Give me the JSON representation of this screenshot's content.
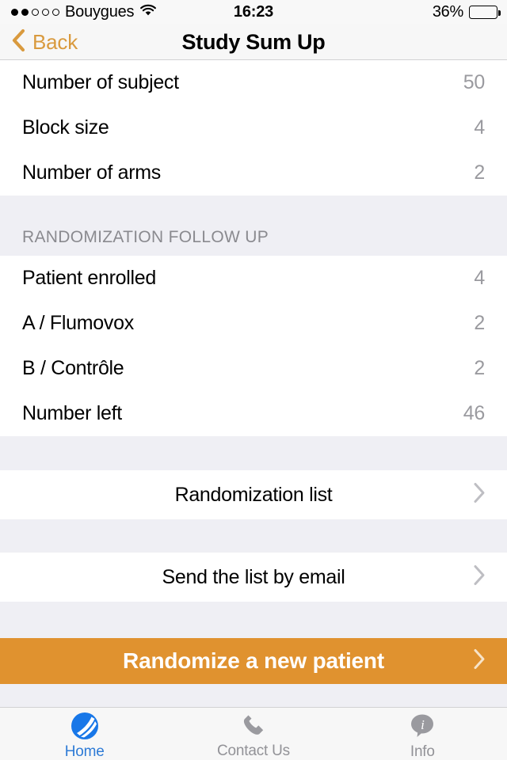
{
  "status_bar": {
    "carrier": "Bouygues",
    "signal_bars_filled": 2,
    "signal_bars_total": 5,
    "wifi_icon": "wifi-icon",
    "time": "16:23",
    "battery_percent": "36%",
    "battery_level": 36
  },
  "nav": {
    "back_label": "Back",
    "back_icon": "chevron-left-icon",
    "title": "Study Sum Up",
    "accent_color": "#D99A3E"
  },
  "study_info": {
    "rows": [
      {
        "label": "Number of subject",
        "value": "50"
      },
      {
        "label": "Block size",
        "value": "4"
      },
      {
        "label": "Number of arms",
        "value": "2"
      }
    ]
  },
  "follow_up": {
    "header": "RANDOMIZATION FOLLOW UP",
    "rows": [
      {
        "label": "Patient enrolled",
        "value": "4"
      },
      {
        "label": "A / Flumovox",
        "value": "2"
      },
      {
        "label": "B / Contrôle",
        "value": "2"
      },
      {
        "label": "Number left",
        "value": "46"
      }
    ]
  },
  "actions": {
    "randomization_list": "Randomization list",
    "send_email": "Send the list by email",
    "chevron_icon": "chevron-right-icon"
  },
  "cta": {
    "label": "Randomize a new patient",
    "chevron_icon": "chevron-right-icon",
    "background_color": "#E0922F",
    "text_color": "#FFFFFF"
  },
  "tab_bar": {
    "tabs": [
      {
        "label": "Home",
        "icon": "globe-swoosh-icon",
        "active": true
      },
      {
        "label": "Contact Us",
        "icon": "phone-icon",
        "active": false
      },
      {
        "label": "Info",
        "icon": "info-bubble-icon",
        "active": false
      }
    ],
    "active_color": "#2E7BD6",
    "inactive_color": "#929297"
  }
}
